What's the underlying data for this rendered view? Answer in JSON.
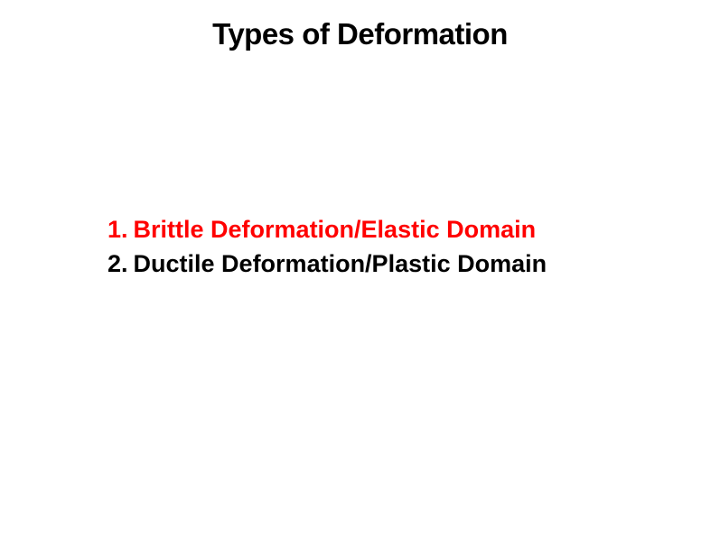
{
  "slide": {
    "title": "Types of Deformation",
    "items": [
      {
        "number": "1.",
        "text": "Brittle Deformation/Elastic Domain",
        "color": "#ff0000"
      },
      {
        "number": "2.",
        "text": "Ductile Deformation/Plastic Domain",
        "color": "#000000"
      }
    ]
  }
}
